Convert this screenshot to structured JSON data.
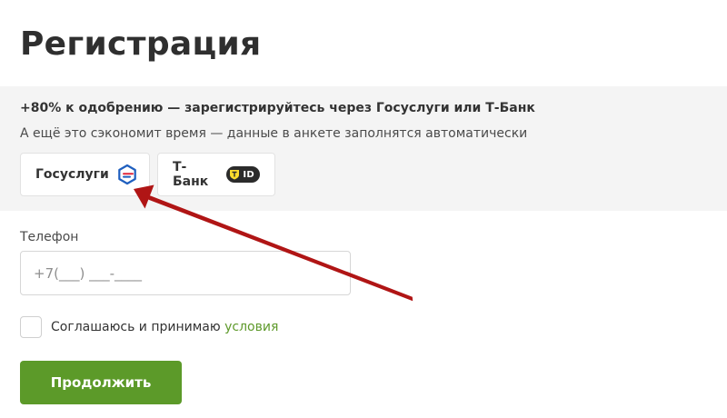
{
  "page": {
    "title": "Регистрация"
  },
  "promo": {
    "headline": "+80% к одобрению — зарегистрируйтесь через Госуслуги или Т-Банк",
    "subtitle": "А ещё это сэкономит время — данные в анкете заполнятся автоматически",
    "providers": [
      {
        "label": "Госуслуги",
        "icon": "gosuslugi-logo-icon"
      },
      {
        "label": "Т-Банк",
        "icon": "tbank-id-icon",
        "badge": "ID"
      }
    ]
  },
  "form": {
    "phone_label": "Телефон",
    "phone_placeholder": "+7(___) ___-____",
    "agree_text": "Соглашаюсь и принимаю ",
    "agree_link": "условия",
    "submit_label": "Продолжить"
  },
  "colors": {
    "accent_green": "#5c9a29",
    "link_green": "#5f9a2c",
    "annotation_arrow": "#b01515",
    "tbank_yellow": "#ffdd2d"
  }
}
